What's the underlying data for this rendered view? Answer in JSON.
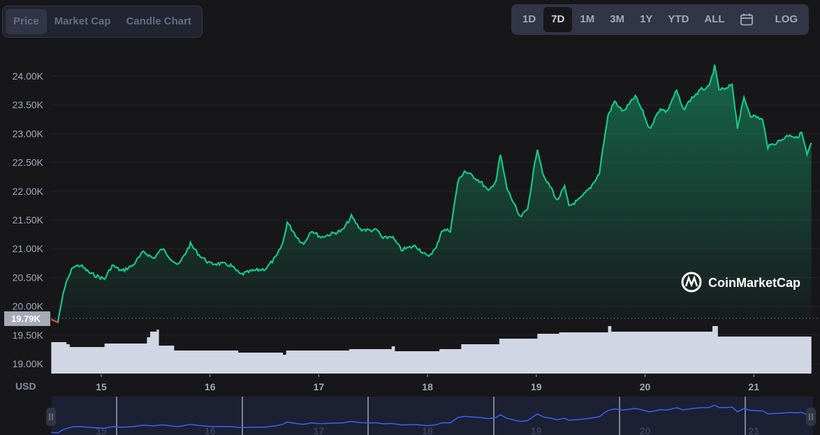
{
  "tabs": [
    {
      "label": "Price",
      "active": true
    },
    {
      "label": "Market Cap",
      "active": false
    },
    {
      "label": "Candle Chart",
      "active": false
    }
  ],
  "ranges": [
    {
      "label": "1D"
    },
    {
      "label": "7D",
      "active": true
    },
    {
      "label": "1M"
    },
    {
      "label": "3M"
    },
    {
      "label": "1Y"
    },
    {
      "label": "YTD"
    },
    {
      "label": "ALL"
    }
  ],
  "calendar_icon": "calendar-icon",
  "log_label": "LOG",
  "logo_text": "CoinMarketCap",
  "colors": {
    "up": "#16c784",
    "down": "#ea3943",
    "volume": "#d0d6e3",
    "navigator_line": "#3861fb",
    "grid": "#222531"
  },
  "chart_data": {
    "type": "area",
    "currency_label": "USD",
    "ylim": [
      18800,
      24300
    ],
    "y_ticks": [
      "19.00K",
      "19.50K",
      "20.00K",
      "20.50K",
      "21.00K",
      "21.50K",
      "22.00K",
      "22.50K",
      "23.00K",
      "23.50K",
      "24.00K"
    ],
    "y_tick_values": [
      19000,
      19500,
      20000,
      20500,
      21000,
      21500,
      22000,
      22500,
      23000,
      23500,
      24000
    ],
    "x_ticks": [
      "15",
      "16",
      "17",
      "18",
      "19",
      "20",
      "21"
    ],
    "x_tick_values": [
      15,
      16,
      17,
      18,
      19,
      20,
      21
    ],
    "xlim": [
      14.54,
      21.53
    ],
    "baseline_label": "19.79K",
    "baseline_value": 19790,
    "price": [
      [
        14.54,
        19770
      ],
      [
        14.6,
        19720
      ],
      [
        14.65,
        20230
      ],
      [
        14.68,
        20410
      ],
      [
        14.74,
        20690
      ],
      [
        14.81,
        20710
      ],
      [
        14.9,
        20570
      ],
      [
        15.03,
        20470
      ],
      [
        15.1,
        20710
      ],
      [
        15.19,
        20610
      ],
      [
        15.29,
        20710
      ],
      [
        15.39,
        20950
      ],
      [
        15.48,
        20830
      ],
      [
        15.56,
        21000
      ],
      [
        15.64,
        20830
      ],
      [
        15.71,
        20710
      ],
      [
        15.82,
        21080
      ],
      [
        15.9,
        20890
      ],
      [
        16.0,
        20740
      ],
      [
        16.1,
        20740
      ],
      [
        16.19,
        20710
      ],
      [
        16.28,
        20550
      ],
      [
        16.38,
        20610
      ],
      [
        16.51,
        20650
      ],
      [
        16.61,
        20860
      ],
      [
        16.67,
        21100
      ],
      [
        16.71,
        21460
      ],
      [
        16.8,
        21200
      ],
      [
        16.86,
        21080
      ],
      [
        16.93,
        21320
      ],
      [
        17.02,
        21200
      ],
      [
        17.12,
        21260
      ],
      [
        17.22,
        21320
      ],
      [
        17.3,
        21560
      ],
      [
        17.38,
        21340
      ],
      [
        17.47,
        21320
      ],
      [
        17.54,
        21320
      ],
      [
        17.59,
        21170
      ],
      [
        17.67,
        21220
      ],
      [
        17.76,
        20980
      ],
      [
        17.89,
        21050
      ],
      [
        18.0,
        20860
      ],
      [
        18.08,
        21010
      ],
      [
        18.13,
        21320
      ],
      [
        18.21,
        21320
      ],
      [
        18.28,
        22170
      ],
      [
        18.34,
        22350
      ],
      [
        18.44,
        22230
      ],
      [
        18.5,
        22140
      ],
      [
        18.56,
        21990
      ],
      [
        18.63,
        22190
      ],
      [
        18.67,
        22630
      ],
      [
        18.73,
        22050
      ],
      [
        18.79,
        21800
      ],
      [
        18.85,
        21540
      ],
      [
        18.92,
        21680
      ],
      [
        18.96,
        22170
      ],
      [
        19.01,
        22750
      ],
      [
        19.07,
        22230
      ],
      [
        19.14,
        22050
      ],
      [
        19.19,
        21830
      ],
      [
        19.26,
        22070
      ],
      [
        19.3,
        21740
      ],
      [
        19.4,
        21860
      ],
      [
        19.5,
        22070
      ],
      [
        19.58,
        22310
      ],
      [
        19.61,
        22710
      ],
      [
        19.66,
        23320
      ],
      [
        19.72,
        23560
      ],
      [
        19.8,
        23380
      ],
      [
        19.85,
        23500
      ],
      [
        19.91,
        23650
      ],
      [
        19.98,
        23380
      ],
      [
        20.04,
        23080
      ],
      [
        20.14,
        23440
      ],
      [
        20.2,
        23380
      ],
      [
        20.29,
        23750
      ],
      [
        20.35,
        23410
      ],
      [
        20.43,
        23620
      ],
      [
        20.52,
        23770
      ],
      [
        20.59,
        23810
      ],
      [
        20.64,
        24170
      ],
      [
        20.68,
        23770
      ],
      [
        20.75,
        23770
      ],
      [
        20.8,
        23870
      ],
      [
        20.85,
        23110
      ],
      [
        20.91,
        23620
      ],
      [
        20.97,
        23320
      ],
      [
        21.04,
        23280
      ],
      [
        21.08,
        23240
      ],
      [
        21.13,
        22770
      ],
      [
        21.2,
        22840
      ],
      [
        21.26,
        22900
      ],
      [
        21.33,
        22990
      ],
      [
        21.39,
        22920
      ],
      [
        21.44,
        23020
      ],
      [
        21.49,
        22630
      ],
      [
        21.53,
        22840
      ]
    ],
    "volume_relative": [
      [
        14.54,
        45
      ],
      [
        14.68,
        42
      ],
      [
        14.71,
        38
      ],
      [
        15.03,
        43
      ],
      [
        15.42,
        52
      ],
      [
        15.45,
        60
      ],
      [
        15.51,
        63
      ],
      [
        15.53,
        40
      ],
      [
        15.67,
        33
      ],
      [
        16.0,
        33
      ],
      [
        16.26,
        30
      ],
      [
        16.67,
        27
      ],
      [
        16.7,
        33
      ],
      [
        17.28,
        35
      ],
      [
        17.67,
        39
      ],
      [
        17.7,
        32
      ],
      [
        18.11,
        35
      ],
      [
        18.31,
        42
      ],
      [
        18.66,
        50
      ],
      [
        19.01,
        57
      ],
      [
        19.21,
        59
      ],
      [
        19.66,
        68
      ],
      [
        19.69,
        60
      ],
      [
        20.62,
        68
      ],
      [
        20.67,
        53
      ],
      [
        21.53,
        55
      ]
    ]
  }
}
